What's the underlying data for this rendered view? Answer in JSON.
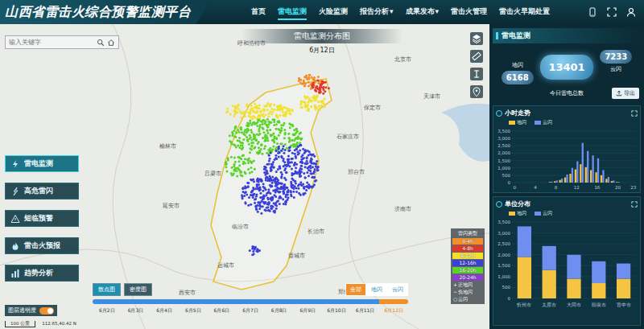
{
  "header": {
    "title": "山西省雷击火综合预警监测平台",
    "dropdown_mark": "▾",
    "nav": [
      {
        "label": "首页",
        "selected": false,
        "dropdown": false
      },
      {
        "label": "雷电监测",
        "selected": true,
        "dropdown": false
      },
      {
        "label": "火险监测",
        "selected": false,
        "dropdown": false
      },
      {
        "label": "报告分析",
        "selected": false,
        "dropdown": true
      },
      {
        "label": "成果发布",
        "selected": false,
        "dropdown": true
      },
      {
        "label": "雷击火管理",
        "selected": false,
        "dropdown": false
      },
      {
        "label": "雷击火早期处置",
        "selected": false,
        "dropdown": false
      }
    ]
  },
  "search": {
    "placeholder": "输入关键字"
  },
  "sidebar": {
    "items": [
      {
        "label": "雷电监测",
        "selected": true
      },
      {
        "label": "高危雷闪",
        "selected": false
      },
      {
        "label": "短临预警",
        "selected": false
      },
      {
        "label": "雷击火预报",
        "selected": false
      },
      {
        "label": "趋势分析",
        "selected": false
      }
    ]
  },
  "map": {
    "title": "雷电监测分布图",
    "date": "6月12日",
    "scale": "100 公里",
    "coordinates": "112.65,40.42 N",
    "cities": [
      "呼和浩特市",
      "北京市",
      "天津市",
      "保定市",
      "石家庄市",
      "邢台市",
      "济南市",
      "榆林市",
      "吕梁市",
      "延安市",
      "临汾市",
      "长治市",
      "晋城市",
      "运城市",
      "西安市",
      "郑州市"
    ]
  },
  "legend": {
    "title": "雷闪类型",
    "items": [
      {
        "label": "0-4h",
        "color": "#f0902a"
      },
      {
        "label": "4-8h",
        "color": "#e0392b"
      },
      {
        "label": "8-12h",
        "color": "#f2e12e"
      },
      {
        "label": "12-16h",
        "color": "#3a3fd8"
      },
      {
        "label": "16-20h",
        "color": "#5ad32a"
      },
      {
        "label": "20-24h",
        "color": "#8a3fd0"
      }
    ],
    "marks": [
      {
        "symbol": "+",
        "label": "正地闪"
      },
      {
        "symbol": "−",
        "label": "负地闪"
      },
      {
        "symbol": "○",
        "label": "云闪"
      }
    ]
  },
  "view_buttons": [
    {
      "label": "散点图",
      "selected": true
    },
    {
      "label": "密度图",
      "selected": false
    }
  ],
  "filters": [
    {
      "label": "全部",
      "selected": true
    },
    {
      "label": "地闪",
      "selected": false
    },
    {
      "label": "云闪",
      "selected": false
    }
  ],
  "timeline": {
    "days": [
      {
        "label": "6月2日",
        "selected": false
      },
      {
        "label": "6月3日",
        "selected": false
      },
      {
        "label": "6月4日",
        "selected": false
      },
      {
        "label": "6月5日",
        "selected": false
      },
      {
        "label": "6月6日",
        "selected": false
      },
      {
        "label": "6月7日",
        "selected": false
      },
      {
        "label": "6月8日",
        "selected": false
      },
      {
        "label": "6月9日",
        "selected": false
      },
      {
        "label": "6月10日",
        "selected": false
      },
      {
        "label": "6月11日",
        "selected": false
      },
      {
        "label": "6月12日",
        "selected": true
      }
    ]
  },
  "opacity_toggle": {
    "label": "图层透明度",
    "on": true
  },
  "right_panel": {
    "title": "雷电监测",
    "total": "13401",
    "total_label": "今日雷电总数",
    "ground": {
      "label": "地闪",
      "value": "6168"
    },
    "cloud": {
      "label": "云闪",
      "value": "7233"
    },
    "export": "导出",
    "hourly": {
      "title": "小时走势",
      "legend": [
        {
          "label": "地闪",
          "color": "#f5c542"
        },
        {
          "label": "云闪",
          "color": "#6e8ef0"
        }
      ],
      "y_ticks": [
        "3,500",
        "3,000",
        "2,500",
        "2,000",
        "1,500",
        "1,000",
        "500",
        "0"
      ],
      "x_ticks": [
        "0",
        "4",
        "8",
        "12",
        "16",
        "20",
        "23"
      ],
      "ground": [
        0,
        0,
        0,
        0,
        0,
        0,
        0,
        40,
        90,
        180,
        350,
        600,
        900,
        1250,
        1050,
        850,
        700,
        500,
        250,
        100,
        40,
        0,
        0,
        0
      ],
      "cloud": [
        0,
        0,
        0,
        0,
        0,
        0,
        0,
        70,
        140,
        280,
        550,
        1000,
        1450,
        2700,
        2150,
        1850,
        1650,
        850,
        380,
        140,
        50,
        0,
        0,
        0
      ]
    },
    "units": {
      "title": "单位分布",
      "legend": [
        {
          "label": "地闪",
          "color": "#f5c542"
        },
        {
          "label": "云闪",
          "color": "#6e8ef0"
        }
      ],
      "y_ticks": [
        "3,500",
        "3,000",
        "2,500",
        "2,000",
        "1,500",
        "1,000",
        "500",
        "0"
      ],
      "categories": [
        "忻州市",
        "太原市",
        "大同市",
        "阳泉市",
        "晋中市"
      ],
      "ground": [
        1900,
        1300,
        900,
        700,
        900
      ],
      "cloud": [
        1400,
        1100,
        1100,
        1000,
        700
      ]
    }
  }
}
